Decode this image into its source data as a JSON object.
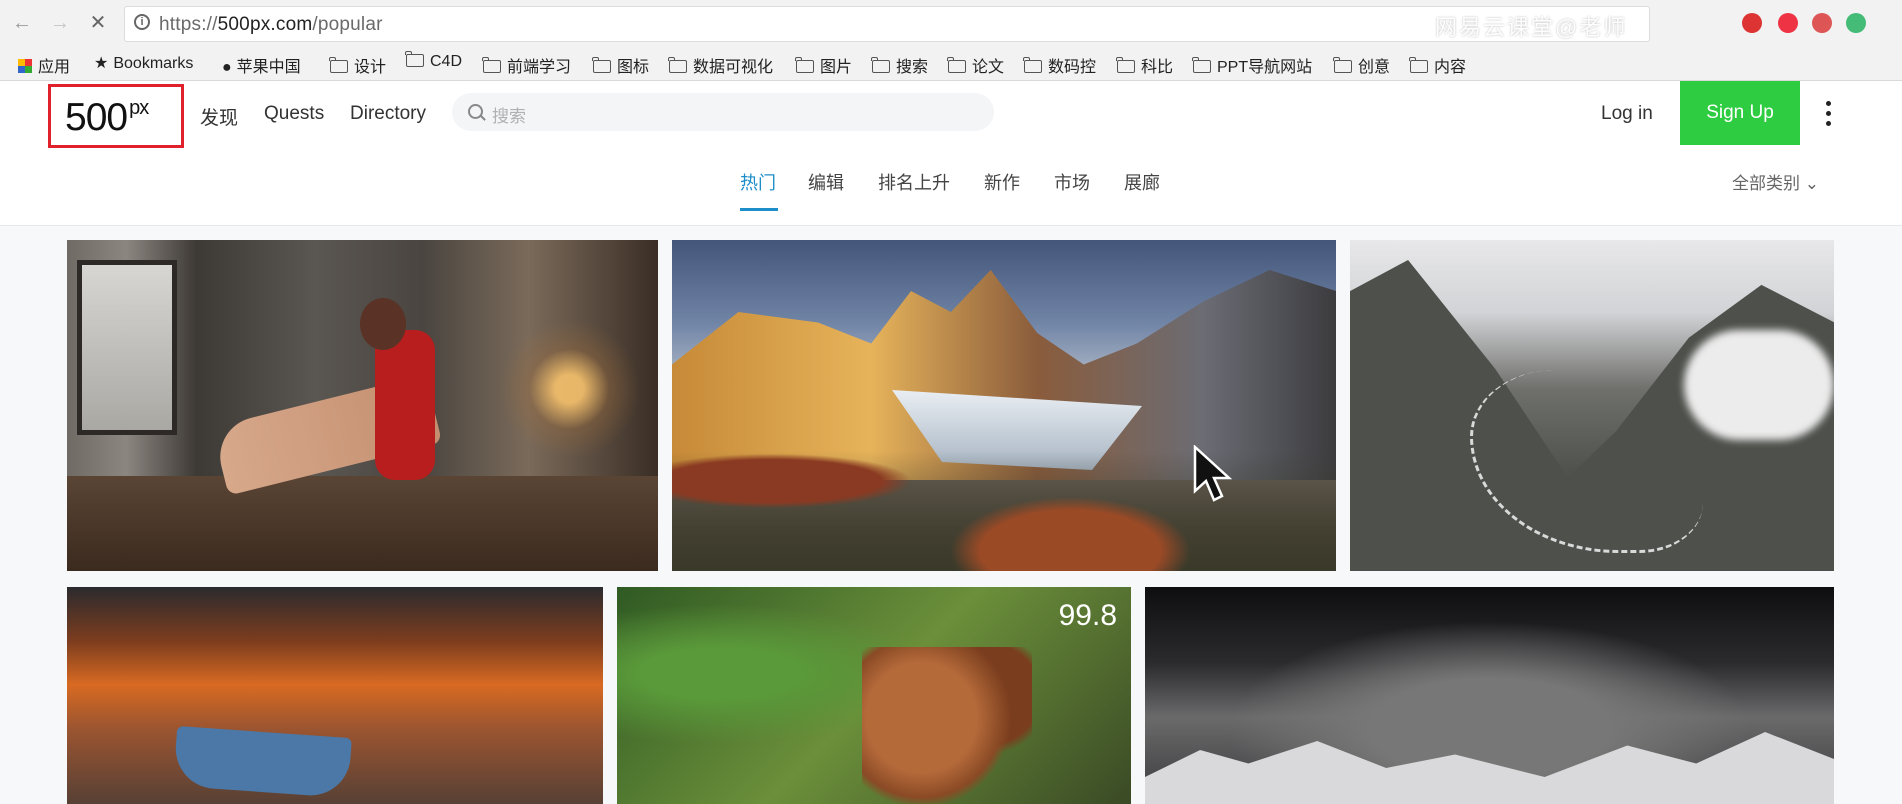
{
  "browser": {
    "url_prefix": "https://",
    "url_host": "500px.com",
    "url_path": "/popular",
    "watermark": "网易云课堂@老师"
  },
  "bookmarks": [
    {
      "label": "应用",
      "icon": "apps-grid-icon"
    },
    {
      "label": "Bookmarks",
      "icon": "star-icon"
    },
    {
      "label": "苹果中国",
      "icon": "apple-icon"
    },
    {
      "label": "设计",
      "icon": "folder-icon"
    },
    {
      "label": "C4D",
      "icon": "folder-icon"
    },
    {
      "label": "前端学习",
      "icon": "folder-icon"
    },
    {
      "label": "图标",
      "icon": "folder-icon"
    },
    {
      "label": "数据可视化",
      "icon": "folder-icon"
    },
    {
      "label": "图片",
      "icon": "folder-icon"
    },
    {
      "label": "搜索",
      "icon": "folder-icon"
    },
    {
      "label": "论文",
      "icon": "folder-icon"
    },
    {
      "label": "数码控",
      "icon": "folder-icon"
    },
    {
      "label": "科比",
      "icon": "folder-icon"
    },
    {
      "label": "PPT导航网站",
      "icon": "folder-icon"
    },
    {
      "label": "创意",
      "icon": "folder-icon"
    },
    {
      "label": "内容",
      "icon": "folder-icon"
    }
  ],
  "header": {
    "logo_main": "500",
    "logo_sup": "px",
    "nav": [
      "发现",
      "Quests",
      "Directory"
    ],
    "search_placeholder": "搜索",
    "login": "Log in",
    "signup": "Sign Up"
  },
  "tabs": {
    "items": [
      "热门",
      "编辑",
      "排名上升",
      "新作",
      "市场",
      "展廊"
    ],
    "active": "热门",
    "all_categories": "全部类别"
  },
  "photos": [
    {
      "subject": "woman in red scarf by window"
    },
    {
      "subject": "mountain peaks with autumn trees"
    },
    {
      "subject": "winding mountain road in clouds"
    },
    {
      "subject": "boat at sunset"
    },
    {
      "subject": "squirrel eating berry",
      "score": "99.8"
    },
    {
      "subject": "stormy snowy mountains"
    }
  ],
  "colors": {
    "accent_blue": "#1d8ec9",
    "signup_green": "#2ecc40",
    "highlight_red": "#e0202a"
  }
}
